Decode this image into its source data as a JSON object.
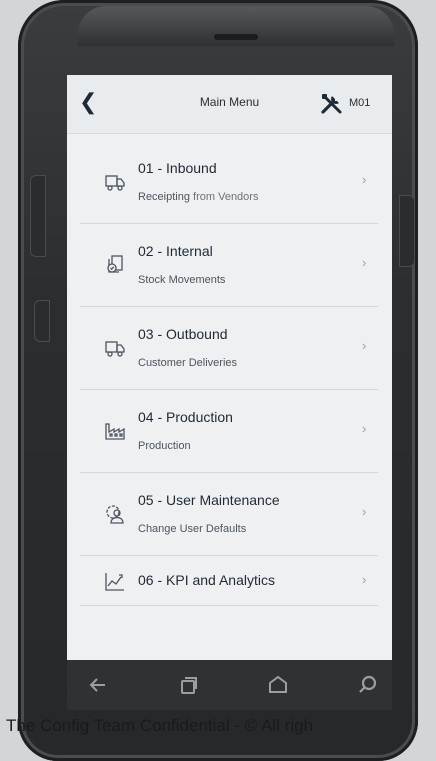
{
  "header": {
    "back_icon": "chevron-left-icon",
    "title": "Main Menu",
    "tools_icon": "tools-icon",
    "tools_code": "M01"
  },
  "menu": [
    {
      "title": "01 - Inbound",
      "subtitle_bold": "Receipting",
      "subtitle_rest": " from Vendors",
      "icon": "truck-icon"
    },
    {
      "title": "02 - Internal",
      "subtitle_bold": "Stock Movements",
      "subtitle_rest": "",
      "icon": "stock-movement-icon"
    },
    {
      "title": "03 - Outbound",
      "subtitle_bold": "Customer Deliveries",
      "subtitle_rest": "",
      "icon": "truck-icon"
    },
    {
      "title": "04 - Production",
      "subtitle_bold": "Production",
      "subtitle_rest": "",
      "icon": "factory-icon"
    },
    {
      "title": "05 - User Maintenance",
      "subtitle_bold": "Change User Defaults",
      "subtitle_rest": "",
      "icon": "user-settings-icon"
    },
    {
      "title": "06 - KPI and Analytics",
      "subtitle_bold": "",
      "subtitle_rest": "",
      "icon": "chart-icon"
    }
  ],
  "chevron": "›",
  "navbar": {
    "back": "android-back-icon",
    "recents": "android-recents-icon",
    "home": "android-home-icon",
    "search": "android-search-icon"
  },
  "footer": "The Config Team Confidential - © All righ"
}
